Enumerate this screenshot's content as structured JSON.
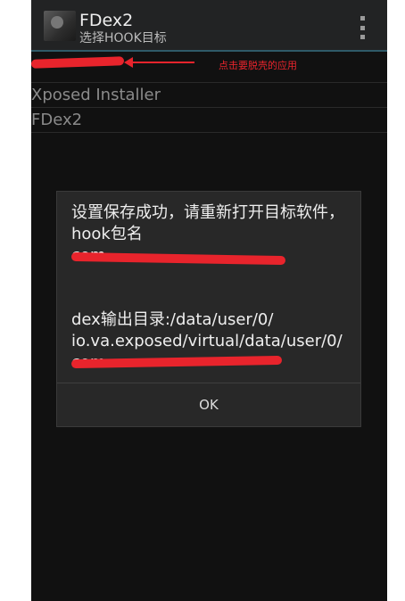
{
  "app": {
    "title": "FDex2",
    "subtitle": "选择HOOK目标"
  },
  "annotation": "点击要脱壳的应用",
  "list": [
    {
      "label": ""
    },
    {
      "label": "Xposed Installer"
    },
    {
      "label": "FDex2"
    }
  ],
  "dialog": {
    "message": "设置保存成功，请重新打开目标软件，hook包名\ncom.\n\n\ndex输出目录:/data/user/0/\nio.va.exposed/virtual/data/user/0/\ncom.",
    "ok_label": "OK"
  },
  "colors": {
    "annotation_red": "#e8242c",
    "actionbar_divider": "#2f5a68"
  }
}
